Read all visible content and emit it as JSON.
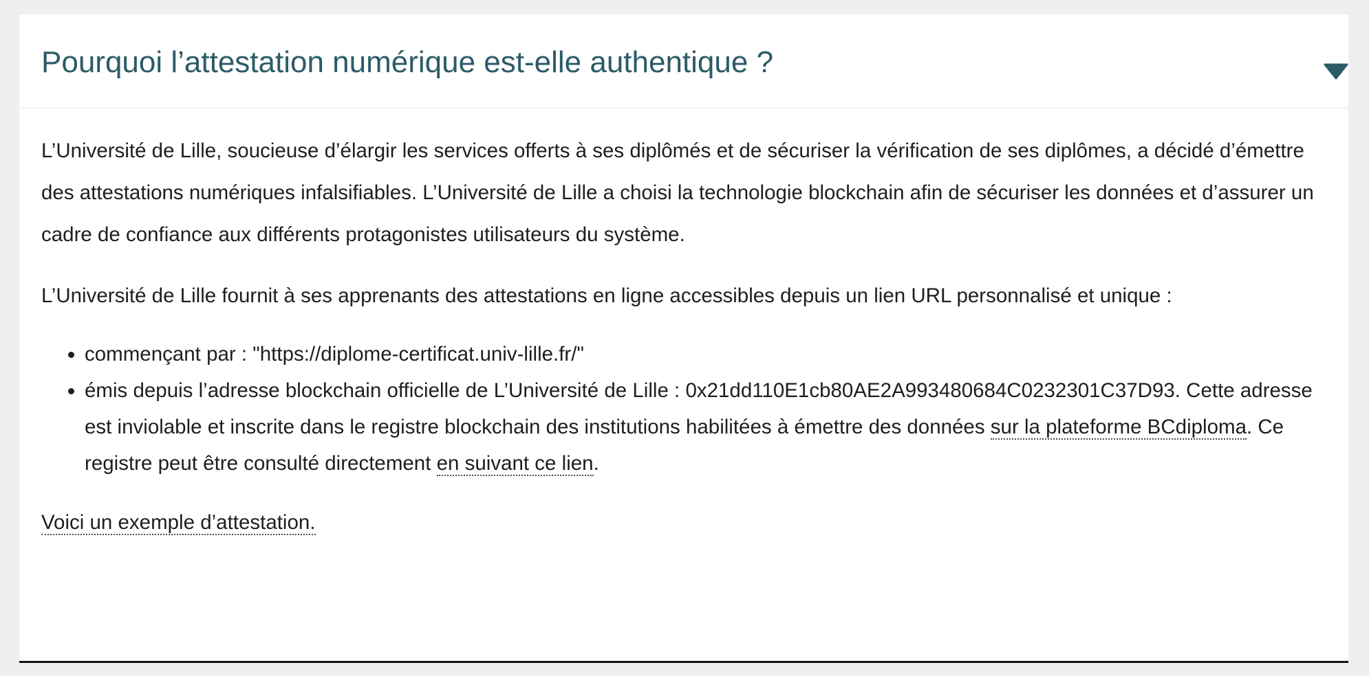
{
  "accordion": {
    "title": "Pourquoi l’attestation numérique est-elle authentique ?",
    "toggle_icon": "caret-down-icon",
    "accent_color": "#2b5b67"
  },
  "content": {
    "paragraph1": "L’Université de Lille, soucieuse d’élargir les services offerts à ses diplômés et de sécuriser la vérification de ses diplômes, a décidé d’émettre des attestations numériques infalsifiables. L’Université de Lille a choisi la technologie blockchain afin de sécuriser les données et d’assurer un cadre de confiance aux différents protagonistes utilisateurs du système.",
    "paragraph2": "L’Université de Lille fournit à ses apprenants des attestations en ligne accessibles depuis un lien URL personnalisé et unique :",
    "bullet1": "commençant par : \"https://diplome-certificat.univ-lille.fr/\"",
    "bullet2_text_before_link1": "émis depuis l’adresse blockchain officielle de L’Université de Lille : 0x21dd110E1cb80AE2A993480684C0232301C37D93. Cette adresse est inviolable et inscrite dans le registre blockchain des institutions habilitées à émettre des données ",
    "bullet2_link1": "sur la plateforme BCdiploma",
    "bullet2_text_between_links": ". Ce registre peut être consulté directement ",
    "bullet2_link2": "en suivant ce lien",
    "bullet2_text_after_link2": ".",
    "example_link": "Voici un exemple d’attestation."
  }
}
